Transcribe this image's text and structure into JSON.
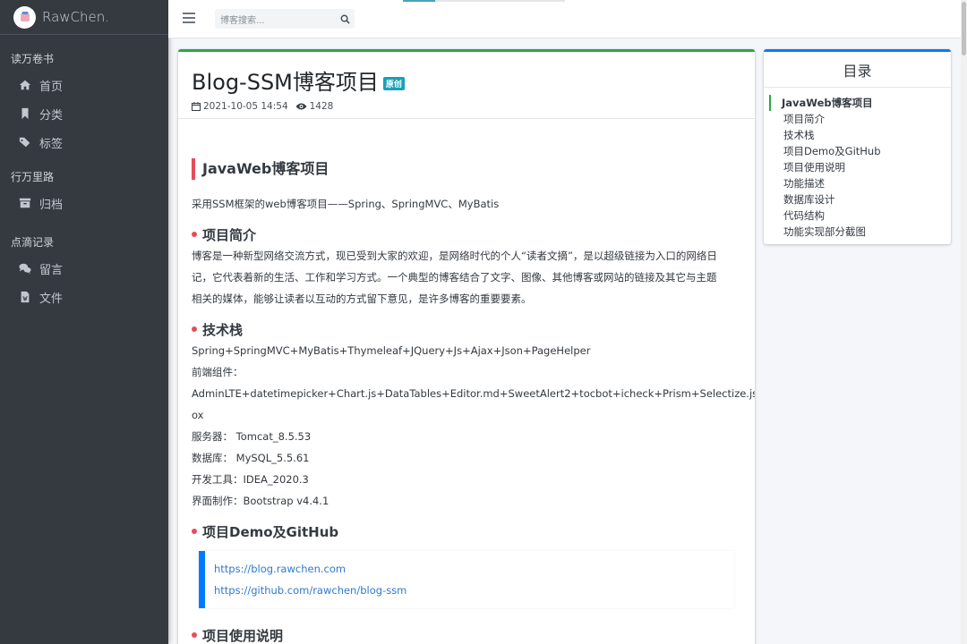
{
  "brand": {
    "name": "RawChen."
  },
  "sidebar": {
    "sections": [
      {
        "header": "读万卷书",
        "items": [
          {
            "label": "首页",
            "icon": "home-icon"
          },
          {
            "label": "分类",
            "icon": "bookmark-icon"
          },
          {
            "label": "标签",
            "icon": "tags-icon"
          }
        ]
      },
      {
        "header": "行万里路",
        "items": [
          {
            "label": "归档",
            "icon": "archive-icon"
          }
        ]
      },
      {
        "header": "点滴记录",
        "items": [
          {
            "label": "留言",
            "icon": "comments-icon"
          },
          {
            "label": "文件",
            "icon": "file-icon"
          }
        ]
      }
    ]
  },
  "topbar": {
    "search_placeholder": "博客搜索..."
  },
  "post": {
    "title": "Blog-SSM博客项目",
    "badge": "原创",
    "date": "2021-10-05 14:54",
    "views": "1428"
  },
  "content": {
    "h1": "JavaWeb博客项目",
    "intro": "采用SSM框架的web博客项目——Spring、SpringMVC、MyBatis",
    "sec1": {
      "title": "项目简介",
      "lines": [
        "博客是一种新型网络交流方式，现已受到大家的欢迎，是网络时代的个人“读者文摘”，是以超级链接为入口的网络日",
        "记，它代表着新的生活、工作和学习方式。一个典型的博客结合了文字、图像、其他博客或网站的链接及其它与主题",
        "相关的媒体，能够让读者以互动的方式留下意见，是许多博客的重要要素。"
      ]
    },
    "sec2": {
      "title": "技术栈",
      "lines": [
        "Spring+SpringMVC+MyBatis+Thymeleaf+JQuery+Js+Ajax+Json+PageHelper",
        "前端组件：",
        "AdminLTE+datetimepicker+Chart.js+DataTables+Editor.md+SweetAlert2+tocbot+icheck+Prism+Selectize.js+Lightb",
        "ox",
        "服务器： Tomcat_8.5.53",
        "数据库： MySQL_5.5.61",
        "开发工具：IDEA_2020.3",
        "界面制作：Bootstrap v4.4.1"
      ]
    },
    "sec3": {
      "title": "项目Demo及GitHub",
      "links": [
        "https://blog.rawchen.com",
        "https://github.com/rawchen/blog-ssm"
      ]
    },
    "sec4": {
      "title": "项目使用说明"
    }
  },
  "toc": {
    "title": "目录",
    "items": [
      "JavaWeb博客项目",
      "项目简介",
      "技术栈",
      "项目Demo及GitHub",
      "项目使用说明",
      "功能描述",
      "数据库设计",
      "代码结构",
      "功能实现部分截图"
    ]
  },
  "colors": {
    "sidebar_bg": "#343a40",
    "card_accent": "#28a745",
    "toc_accent": "#007bff",
    "heading_marker": "#e74c5c",
    "badge": "#17a2b8",
    "link": "#2f7ad1"
  }
}
